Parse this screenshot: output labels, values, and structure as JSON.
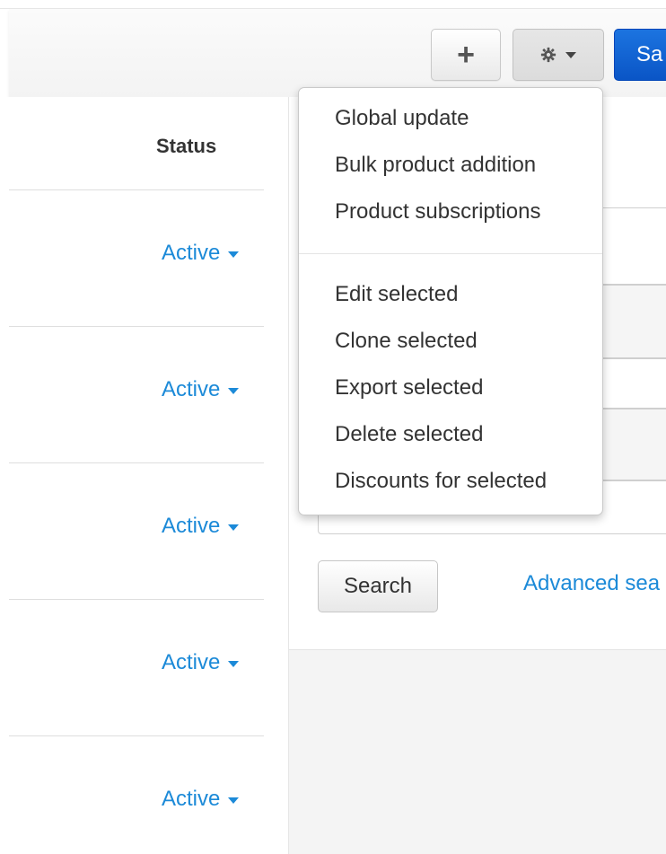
{
  "toolbar": {
    "add_label": "+",
    "gear_icon": "gear-icon",
    "save_label": "Sa"
  },
  "table": {
    "header_status": "Status",
    "rows": [
      {
        "status": "Active"
      },
      {
        "status": "Active"
      },
      {
        "status": "Active"
      },
      {
        "status": "Active"
      },
      {
        "status": "Active"
      }
    ]
  },
  "search_panel": {
    "search_label": "Search",
    "advanced_label": "Advanced sea"
  },
  "dropdown": {
    "group1": [
      "Global update",
      "Bulk product addition",
      "Product subscriptions"
    ],
    "group2": [
      "Edit selected",
      "Clone selected",
      "Export selected",
      "Delete selected",
      "Discounts for selected"
    ]
  },
  "colors": {
    "link": "#1c8ad8",
    "primary": "#0a55c6"
  }
}
